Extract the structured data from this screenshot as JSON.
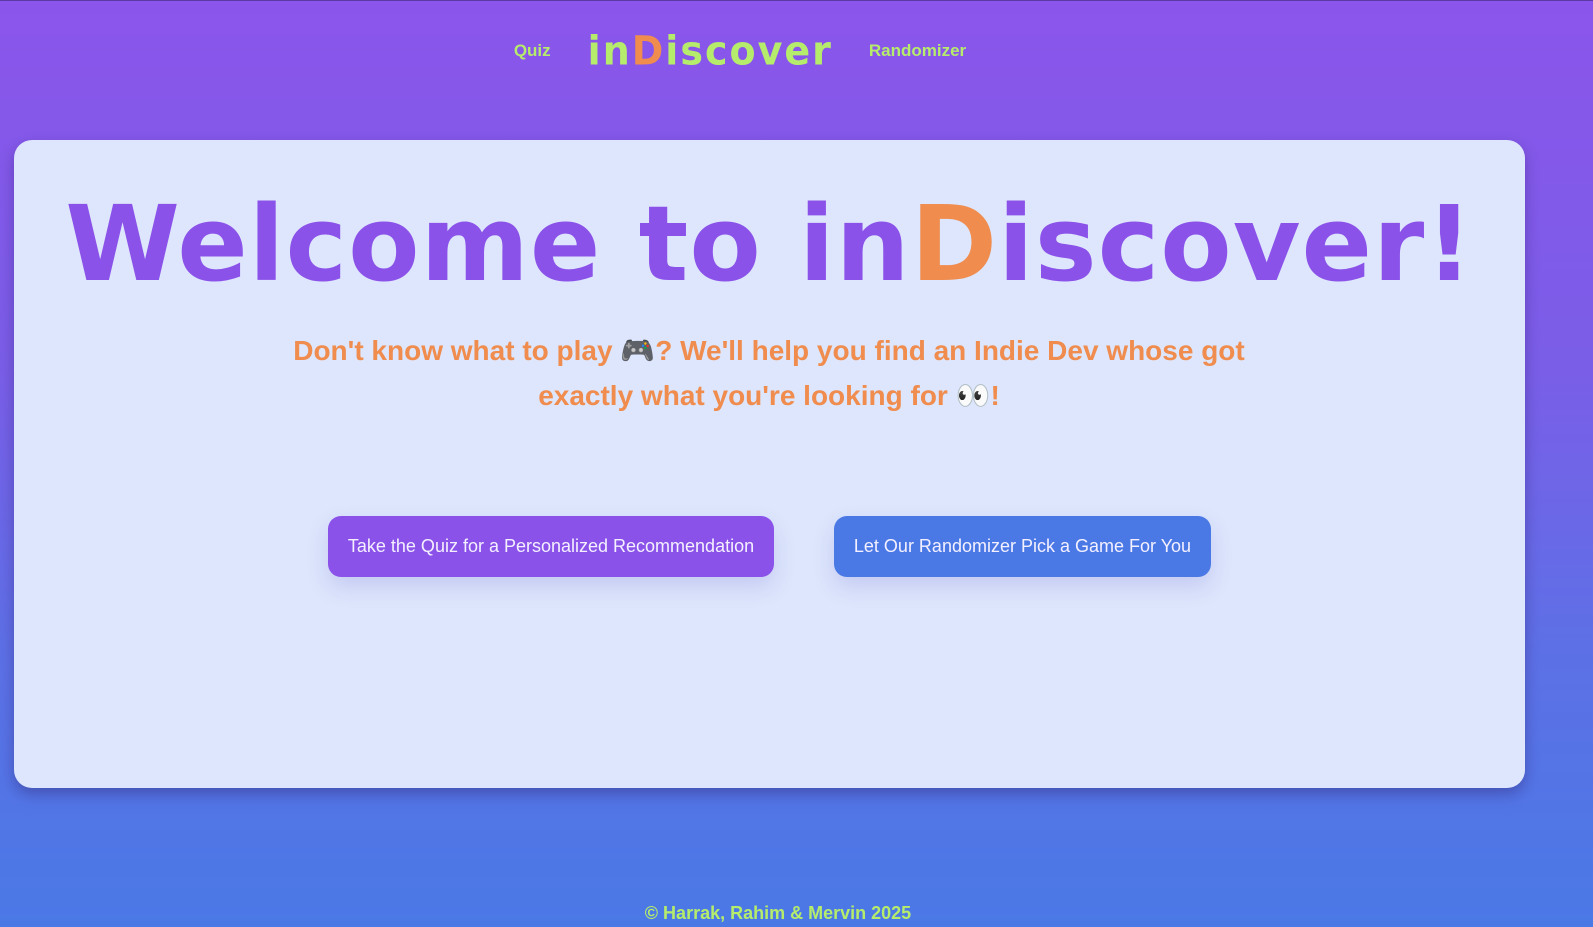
{
  "nav": {
    "quiz_label": "Quiz",
    "logo_prefix": "in",
    "logo_highlight": "D",
    "logo_suffix": "iscover",
    "randomizer_label": "Randomizer"
  },
  "hero": {
    "headline_prefix": "Welcome to in",
    "headline_highlight": "D",
    "headline_suffix": "iscover!",
    "subtitle_part1": "Don't know what to play ",
    "subtitle_emoji1": "🎮",
    "subtitle_part2": "? We'll help you find an Indie Dev whose got exactly what you're looking for ",
    "subtitle_emoji2": "👀",
    "subtitle_part3": "!"
  },
  "buttons": {
    "quiz_label": "Take the Quiz for a Personalized Recommendation",
    "randomizer_label": "Let Our Randomizer Pick a Game For You"
  },
  "footer": {
    "copyright": "© Harrak, Rahim & Mervin 2025"
  },
  "colors": {
    "background_top": "#8b55eb",
    "background_bottom": "#4a79e6",
    "accent_green": "#b6ec6b",
    "accent_orange": "#ef8c4e",
    "purple": "#8b52ea",
    "blue": "#4a79e6",
    "card": "#dde6fc"
  }
}
